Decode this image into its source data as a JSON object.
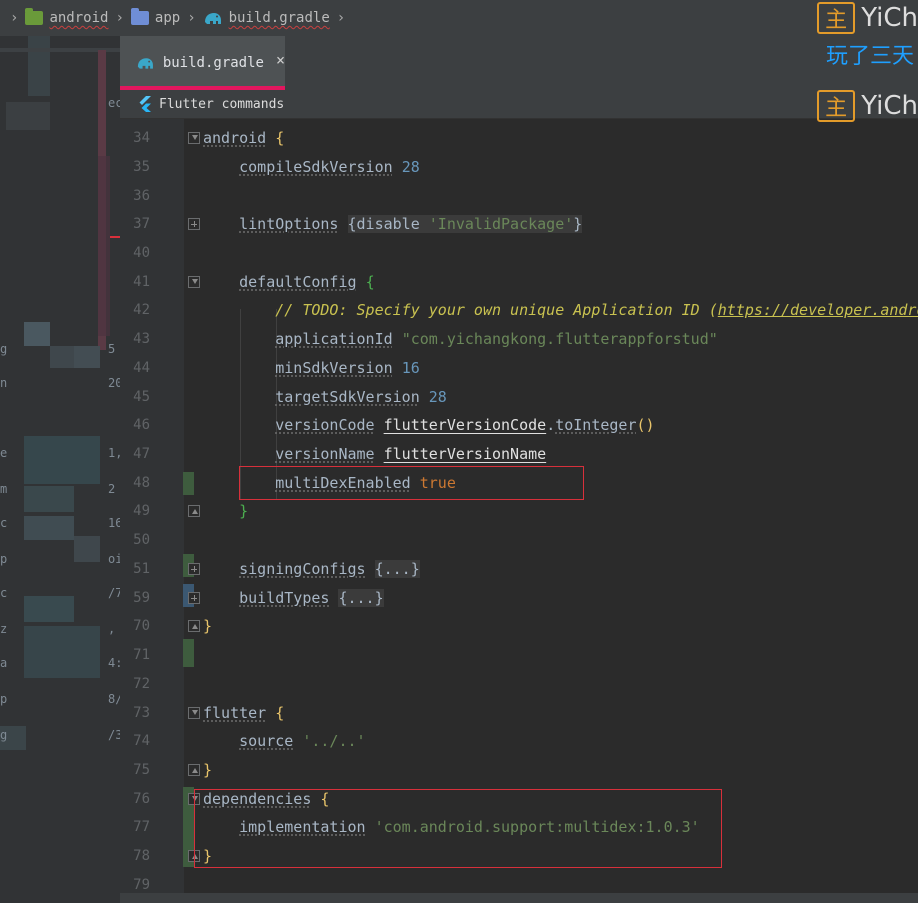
{
  "breadcrumb": {
    "items": [
      {
        "label": "android",
        "icon": "android-folder-icon",
        "color": "#6a9a3a"
      },
      {
        "label": "app",
        "icon": "module-folder-icon",
        "color": "#6f8ed6"
      },
      {
        "label": "build.gradle",
        "icon": "gradle-elephant-icon",
        "color": "#3aa7c9"
      }
    ]
  },
  "tabs": [
    {
      "label": "build.gradle",
      "icon": "gradle-elephant-icon",
      "active": true,
      "close": "×"
    }
  ],
  "toolbar": {
    "flutter_commands": "Flutter commands"
  },
  "editor": {
    "line_numbers": [
      "34",
      "35",
      "36",
      "37",
      "40",
      "41",
      "42",
      "43",
      "44",
      "45",
      "46",
      "47",
      "48",
      "49",
      "50",
      "51",
      "59",
      "70",
      "71",
      "72",
      "73",
      "74",
      "75",
      "76",
      "77",
      "78",
      "79"
    ],
    "lines": {
      "l34": {
        "name": "android",
        "brace": "{"
      },
      "l35": {
        "key": "compileSdkVersion",
        "value": "28"
      },
      "l37": {
        "key": "lintOptions",
        "open": "{",
        "inner": "disable",
        "str": "'InvalidPackage'",
        "close": "}"
      },
      "l41": {
        "key": "defaultConfig",
        "brace": "{"
      },
      "l42": {
        "comment": "// TODO: Specify your own unique Application ID (",
        "url": "https://developer.andro"
      },
      "l43": {
        "key": "applicationId",
        "str": "\"com.yichangkong.flutterappforstud\""
      },
      "l44": {
        "key": "minSdkVersion",
        "value": "16"
      },
      "l45": {
        "key": "targetSdkVersion",
        "value": "28"
      },
      "l46": {
        "key": "versionCode",
        "ref": "flutterVersionCode",
        "dot": ".",
        "method": "toInteger",
        "parens": "()"
      },
      "l47": {
        "key": "versionName",
        "ref": "flutterVersionName"
      },
      "l48": {
        "key": "multiDexEnabled",
        "bool": "true"
      },
      "l49": {
        "brace": "}"
      },
      "l51": {
        "key": "signingConfigs",
        "folded": "{...}"
      },
      "l59": {
        "key": "buildTypes",
        "folded": "{...}"
      },
      "l70": {
        "brace": "}"
      },
      "l73": {
        "name": "flutter",
        "brace": "{"
      },
      "l74": {
        "key": "source",
        "str": "'../..'"
      },
      "l75": {
        "brace": "}"
      },
      "l76": {
        "name": "dependencies",
        "brace": "{"
      },
      "l77": {
        "key": "implementation",
        "str": "'com.android.support:multidex:1.0.3'"
      },
      "l78": {
        "brace": "}"
      }
    }
  },
  "notifications": [
    {
      "badge": "主",
      "name": "YiCh"
    },
    {
      "sub": "玩了三天"
    },
    {
      "badge": "主",
      "name": "YiCh"
    }
  ],
  "left_panel_fragments": [
    "g",
    "n",
    "e",
    "m",
    "c",
    "p",
    "c",
    "z",
    "a",
    "p",
    "g",
    "ec",
    "5",
    "20",
    "1,",
    "2",
    "16",
    "oi",
    "/7",
    ",",
    "4:",
    "8/",
    "/3"
  ],
  "colors": {
    "keyword": "#a9b7c6",
    "number": "#6897bb",
    "string": "#6a8759",
    "boolean": "#cc7832",
    "comment": "#c9c250",
    "highlight_box": "#d8303b",
    "active_tab_underline": "#e2165e"
  }
}
